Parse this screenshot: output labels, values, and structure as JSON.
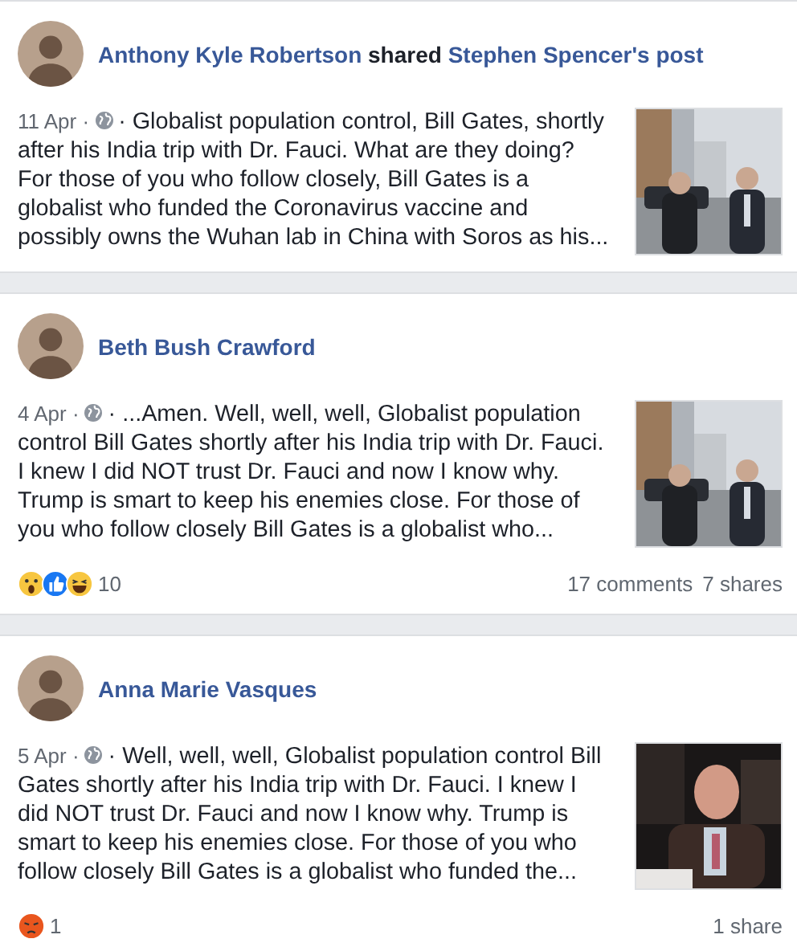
{
  "posts": [
    {
      "author": "Anthony Kyle Robertson",
      "action": "shared",
      "shared_post": "Stephen Spencer's post",
      "date": "11 Apr ·",
      "text": "· Globalist population control, Bill Gates, shortly after his India trip with Dr. Fauci. What are they doing? For those of you who follow closely, Bill Gates is a globalist who funded the Coronavirus vaccine and possibly owns the Wuhan lab in China with Soros as his...",
      "picture": {
        "kind": "street"
      }
    },
    {
      "author": "Beth Bush Crawford",
      "date": "4 Apr ·",
      "text": "· ...Amen. Well, well, well, Globalist population control Bill Gates shortly after his India trip with Dr. Fauci. I knew I did NOT trust Dr. Fauci and now I know why. Trump is smart to keep his enemies close. For those of you who follow closely Bill Gates is a globalist who...",
      "picture": {
        "kind": "street"
      },
      "reactions": [
        {
          "kind": "wow"
        },
        {
          "kind": "like"
        },
        {
          "kind": "haha"
        }
      ],
      "reaction_count": "10",
      "comments": "17 comments",
      "shares": "7 shares"
    },
    {
      "author": "Anna Marie Vasques",
      "date": "5 Apr ·",
      "text": "· Well, well, well, Globalist population control Bill Gates shortly after his India trip with Dr. Fauci. I knew I did NOT trust Dr. Fauci and now I know why. Trump is smart to keep his enemies close. For those of you who follow closely Bill Gates is a globalist who funded the...",
      "picture": {
        "kind": "speaker"
      },
      "reactions": [
        {
          "kind": "angry"
        }
      ],
      "reaction_count": "1",
      "shares": "1 share"
    }
  ]
}
